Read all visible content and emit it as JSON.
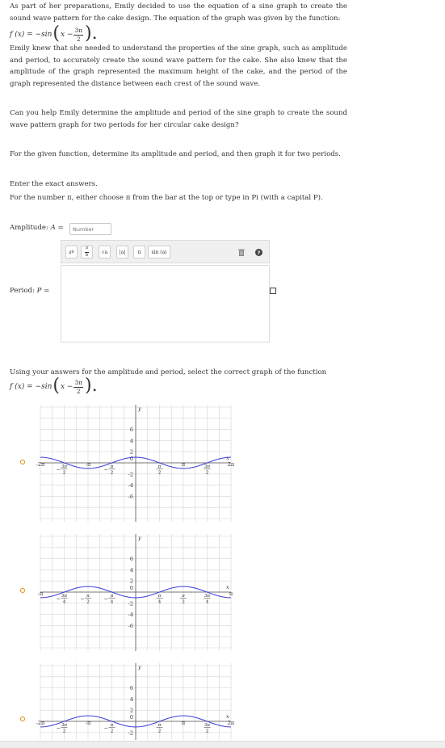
{
  "intro": "As part of her preparations, Emily decided to use the equation of a sine graph to create the sound wave pattern for the cake design. The equation of the graph was given by the function:",
  "function_prefix": "f (x) = −sin",
  "function_inner": "x −",
  "frac_num": "3π",
  "frac_den": "2",
  "paragraph2": "Emily knew that she needed to understand the properties of the sine graph, such as amplitude and period, to accurately create the sound wave pattern for the cake. She also knew that the amplitude of the graph represented the maximum height of the cake, and the period of the graph represented the distance between each crest of the sound wave.",
  "question": "Can you help Emily determine the amplitude and period of the sine graph to create the sound wave pattern graph for two periods for her circular cake design?",
  "instruction": "For the given function, determine its amplitude and period, and then graph it for two periods.",
  "exact_note": "Enter the exact answers.",
  "pi_note": "For the number π, either choose π from the bar at the top or type in Pi (with a capital P).",
  "amplitude_label": "Amplitude:",
  "amplitude_var": "A =",
  "amplitude_placeholder": "Number",
  "period_label": "Period:",
  "period_var": "P =",
  "toolbar": {
    "frac": {
      "num": "a",
      "den": "b"
    },
    "power": "a",
    "power_exp": "b",
    "sqrt": "√a",
    "abs": "|a|",
    "pi": "π",
    "sin": "sin (a)",
    "delete_icon": "trash-icon",
    "help_icon": "help-icon"
  },
  "graph_prompt": "Using your answers for the amplitude and period, select the correct graph of the function",
  "graph_options": [
    {
      "y_ticks": [
        "6",
        "4",
        "2",
        "-2",
        "-4",
        "-6"
      ],
      "x_ticks": [
        {
          "t": "-2π"
        },
        {
          "t": "−3π/2",
          "num": "3π",
          "den": "2",
          "neg": true
        },
        {
          "t": "-π"
        },
        {
          "t": "−π/2",
          "num": "π",
          "den": "2",
          "neg": true
        },
        {
          "t": "π/2",
          "num": "π",
          "den": "2"
        },
        {
          "t": "π"
        },
        {
          "t": "3π/2",
          "num": "3π",
          "den": "2"
        },
        {
          "t": "2π"
        }
      ],
      "y_axis_label": "y",
      "x_axis_label": "x",
      "zero_label": "0"
    },
    {
      "y_ticks": [
        "6",
        "4",
        "2",
        "-2",
        "-4",
        "-6"
      ],
      "x_ticks": [
        {
          "t": "-π"
        },
        {
          "t": "−3π/4",
          "num": "3π",
          "den": "4",
          "neg": true
        },
        {
          "t": "−π/2",
          "num": "π",
          "den": "2",
          "neg": true
        },
        {
          "t": "−π/4",
          "num": "π",
          "den": "4",
          "neg": true
        },
        {
          "t": "π/4",
          "num": "π",
          "den": "4"
        },
        {
          "t": "π/2",
          "num": "π",
          "den": "2"
        },
        {
          "t": "3π/4",
          "num": "3π",
          "den": "4"
        },
        {
          "t": "π"
        }
      ],
      "y_axis_label": "y",
      "x_axis_label": "x",
      "zero_label": "0"
    },
    {
      "y_ticks": [
        "6",
        "4",
        "2",
        "-2"
      ],
      "x_ticks": [
        {
          "t": "-2π"
        },
        {
          "t": "−3π/2",
          "num": "3π",
          "den": "2",
          "neg": true
        },
        {
          "t": "-π"
        },
        {
          "t": "−π/2",
          "num": "π",
          "den": "2",
          "neg": true
        },
        {
          "t": "π/2",
          "num": "π",
          "den": "2"
        },
        {
          "t": "π"
        },
        {
          "t": "3π/2",
          "num": "3π",
          "den": "2"
        },
        {
          "t": "2π"
        }
      ],
      "y_axis_label": "y",
      "x_axis_label": "x",
      "zero_label": "0"
    }
  ],
  "colors": {
    "curve": "#3b3bdc",
    "grid": "#d6d6d6",
    "radio": "#e08a00"
  }
}
